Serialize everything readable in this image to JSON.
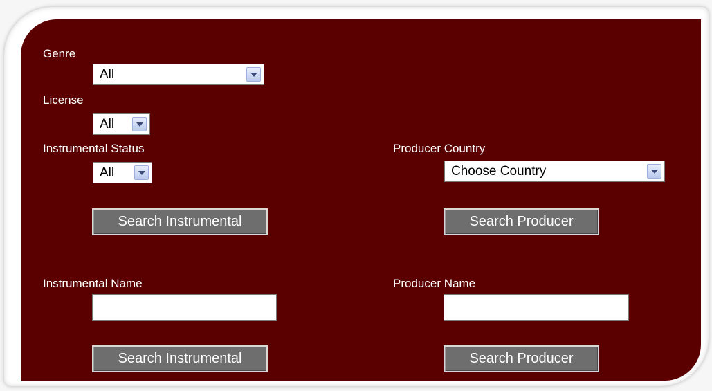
{
  "genre": {
    "label": "Genre",
    "value": "All"
  },
  "license": {
    "label": "License",
    "value": "All"
  },
  "instrumental_status": {
    "label": "Instrumental Status",
    "value": "All"
  },
  "producer_country": {
    "label": "Producer Country",
    "value": "Choose Country"
  },
  "search_instrumental_label": "Search Instrumental",
  "search_producer_label": "Search Producer",
  "instrumental_name": {
    "label": "Instrumental Name",
    "value": ""
  },
  "producer_name": {
    "label": "Producer Name",
    "value": ""
  },
  "colors": {
    "panel": "#5a0000",
    "button": "#6e6e6e",
    "text": "#ffffff"
  }
}
